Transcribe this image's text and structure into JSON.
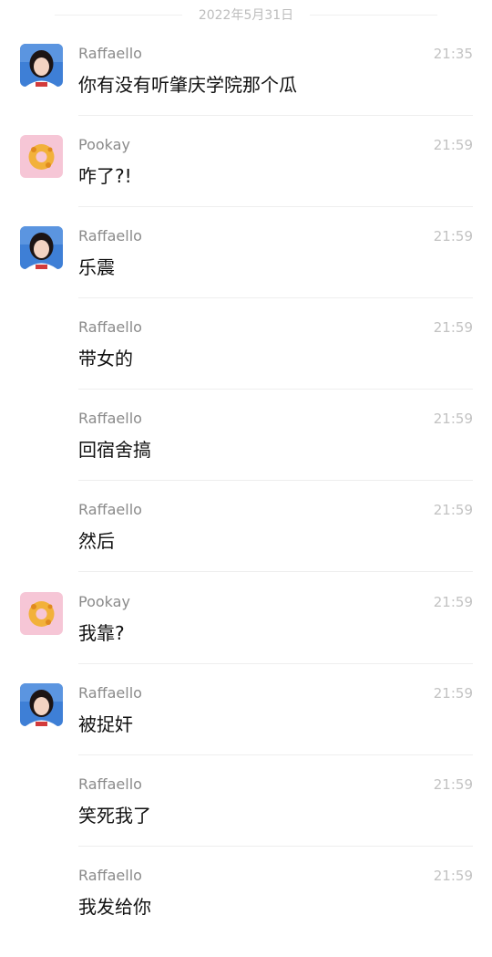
{
  "chat": {
    "date": "2022年5月31日",
    "messages": [
      {
        "avatar": "raffaello-photo",
        "sender": "Raffaello",
        "time": "21:35",
        "text": "你有没有听肇庆学院那个瓜"
      },
      {
        "avatar": "pookay-cat",
        "sender": "Pookay",
        "time": "21:59",
        "text": "咋了?!"
      },
      {
        "avatar": "raffaello-photo",
        "sender": "Raffaello",
        "time": "21:59",
        "text": "乐震"
      },
      {
        "avatar": "",
        "sender": "Raffaello",
        "time": "21:59",
        "text": "带女的"
      },
      {
        "avatar": "",
        "sender": "Raffaello",
        "time": "21:59",
        "text": "回宿舍搞"
      },
      {
        "avatar": "",
        "sender": "Raffaello",
        "time": "21:59",
        "text": "然后"
      },
      {
        "avatar": "pookay-cat",
        "sender": "Pookay",
        "time": "21:59",
        "text": "我靠?"
      },
      {
        "avatar": "raffaello-photo",
        "sender": "Raffaello",
        "time": "21:59",
        "text": "被捉奸"
      },
      {
        "avatar": "",
        "sender": "Raffaello",
        "time": "21:59",
        "text": "笑死我了"
      },
      {
        "avatar": "",
        "sender": "Raffaello",
        "time": "21:59",
        "text": "我发给你"
      }
    ]
  }
}
